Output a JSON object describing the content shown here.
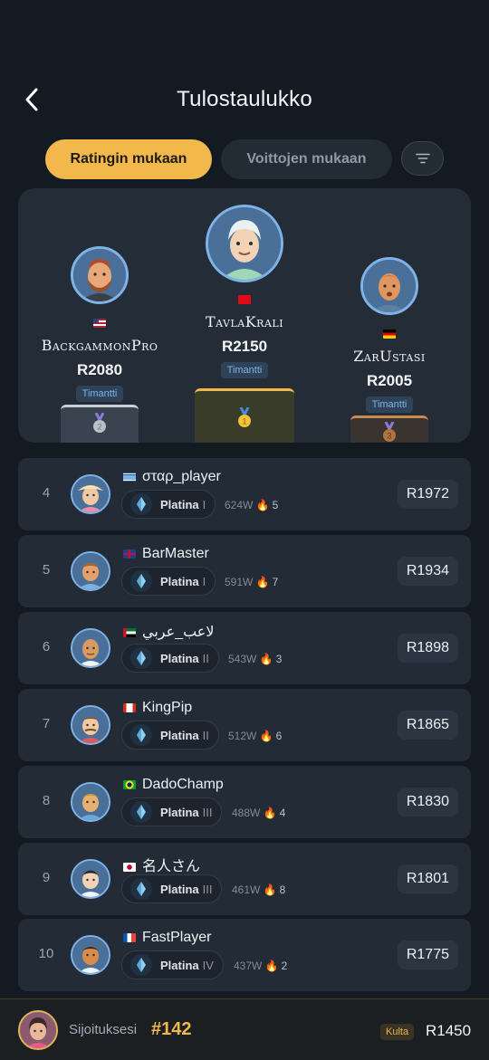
{
  "header": {
    "title": "Tulostaulukko"
  },
  "tabs": [
    {
      "label": "Ratingin mukaan",
      "active": true
    },
    {
      "label": "Voittojen mukaan",
      "active": false
    }
  ],
  "podium": [
    {
      "place": 2,
      "name": "BackgammonPro",
      "flag": "us",
      "rating": "R2080",
      "tier": "Timantti",
      "medal": "2"
    },
    {
      "place": 1,
      "name": "TavlaKrali",
      "flag": "tr",
      "rating": "R2150",
      "tier": "Timantti",
      "medal": "1"
    },
    {
      "place": 3,
      "name": "ZarUstasi",
      "flag": "de",
      "rating": "R2005",
      "tier": "Timantti",
      "medal": "3"
    }
  ],
  "rows": [
    {
      "rank": "4",
      "name": "σταρ_player",
      "flag": "gr",
      "tier": "Platina",
      "level": "I",
      "wins": "624W",
      "streak": "5",
      "rating": "R1972"
    },
    {
      "rank": "5",
      "name": "BarMaster",
      "flag": "gb",
      "tier": "Platina",
      "level": "I",
      "wins": "591W",
      "streak": "7",
      "rating": "R1934"
    },
    {
      "rank": "6",
      "name": "لاعب_عربي",
      "flag": "ae",
      "tier": "Platina",
      "level": "II",
      "wins": "543W",
      "streak": "3",
      "rating": "R1898"
    },
    {
      "rank": "7",
      "name": "KingPip",
      "flag": "ca",
      "tier": "Platina",
      "level": "II",
      "wins": "512W",
      "streak": "6",
      "rating": "R1865"
    },
    {
      "rank": "8",
      "name": "DadoChamp",
      "flag": "br",
      "tier": "Platina",
      "level": "III",
      "wins": "488W",
      "streak": "4",
      "rating": "R1830"
    },
    {
      "rank": "9",
      "name": "名人さん",
      "flag": "jp",
      "tier": "Platina",
      "level": "III",
      "wins": "461W",
      "streak": "8",
      "rating": "R1801"
    },
    {
      "rank": "10",
      "name": "FastPlayer",
      "flag": "fr",
      "tier": "Platina",
      "level": "IV",
      "wins": "437W",
      "streak": "2",
      "rating": "R1775"
    }
  ],
  "footer": {
    "label": "Sijoituksesi",
    "position": "#142",
    "tier": "Kulta",
    "rating": "R1450"
  },
  "colors": {
    "accent": "#f2b84b",
    "background": "#141a21",
    "card": "#232b36",
    "diamond": "#7fb3e8"
  },
  "icons": {
    "back": "chevron-left-icon",
    "filter": "filter-icon",
    "tier": "platinum-gem-icon",
    "streak": "flame-icon"
  }
}
